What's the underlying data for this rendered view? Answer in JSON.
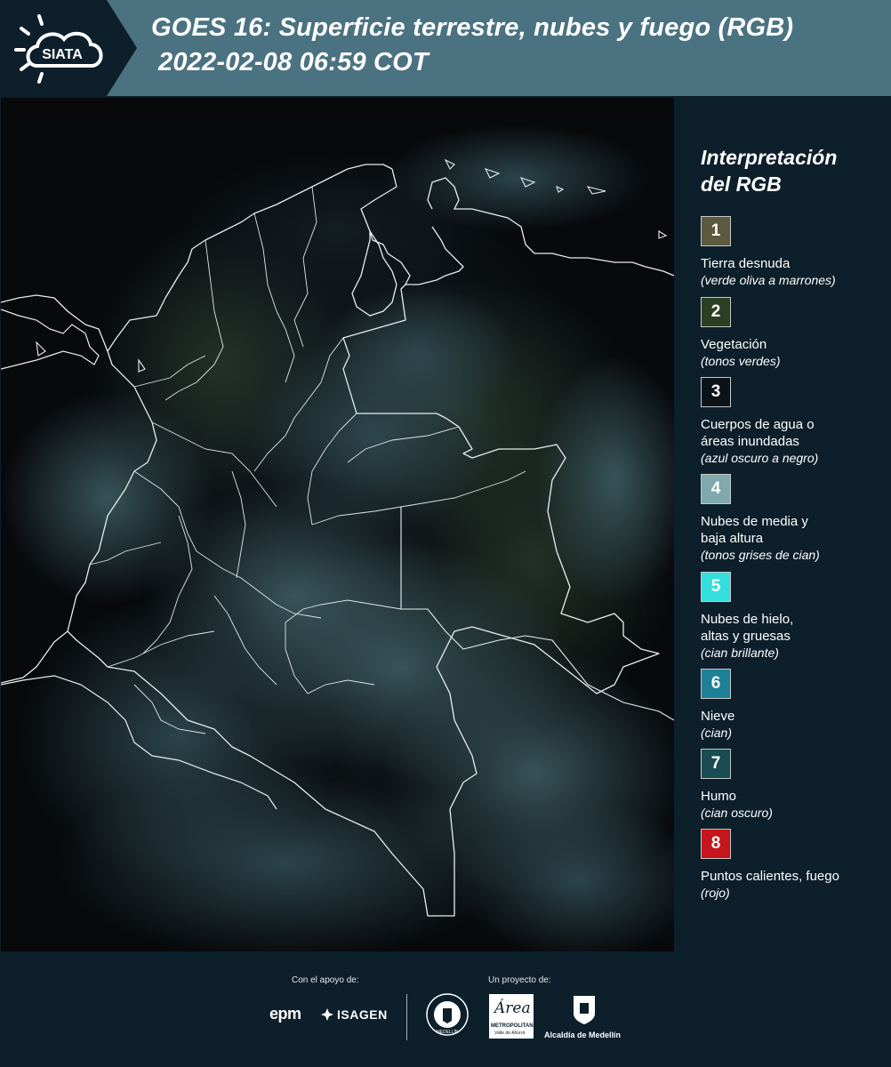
{
  "header": {
    "logo_text": "SIATA",
    "title_line1": "GOES 16: Superficie terrestre, nubes y fuego (RGB)",
    "title_line2": "2022-02-08 06:59 COT"
  },
  "legend": {
    "title_line1": "Interpretación",
    "title_line2": "del RGB",
    "items": [
      {
        "num": "1",
        "label": "Tierra desnuda",
        "desc": "(verde oliva a marrones)",
        "color": "#5c5a3e"
      },
      {
        "num": "2",
        "label": "Vegetación",
        "desc": "(tonos verdes)",
        "color": "#2b3f22"
      },
      {
        "num": "3",
        "label": "Cuerpos de agua o áreas inundadas",
        "desc": "(azul oscuro a negro)",
        "color": "#0b1319"
      },
      {
        "num": "4",
        "label": "Nubes de media y baja altura",
        "desc": "(tonos grises de cian)",
        "color": "#7fa9ac"
      },
      {
        "num": "5",
        "label": "Nubes de hielo, altas y gruesas",
        "desc": "(cian brillante)",
        "color": "#33dedd"
      },
      {
        "num": "6",
        "label": "Nieve",
        "desc": "(cian)",
        "color": "#1e8097"
      },
      {
        "num": "7",
        "label": "Humo",
        "desc": "(cian oscuro)",
        "color": "#1a4d52"
      },
      {
        "num": "8",
        "label": "Puntos calientes, fuego",
        "desc": "(rojo)",
        "color": "#c4161c"
      }
    ]
  },
  "footer": {
    "support_label": "Con el apoyo de:",
    "project_label": "Un proyecto de:",
    "epm": "epm",
    "isagen": "ISAGEN",
    "metro_name": "Área",
    "metro_sub1": "METROPOLITANA",
    "metro_sub2": "Valle de Aburrá",
    "alcaldia": "Alcaldía de Medellín",
    "seal_text": "MEDELLÍN"
  },
  "colors": {
    "header_band": "#4a7281",
    "background": "#0c1f2a"
  }
}
